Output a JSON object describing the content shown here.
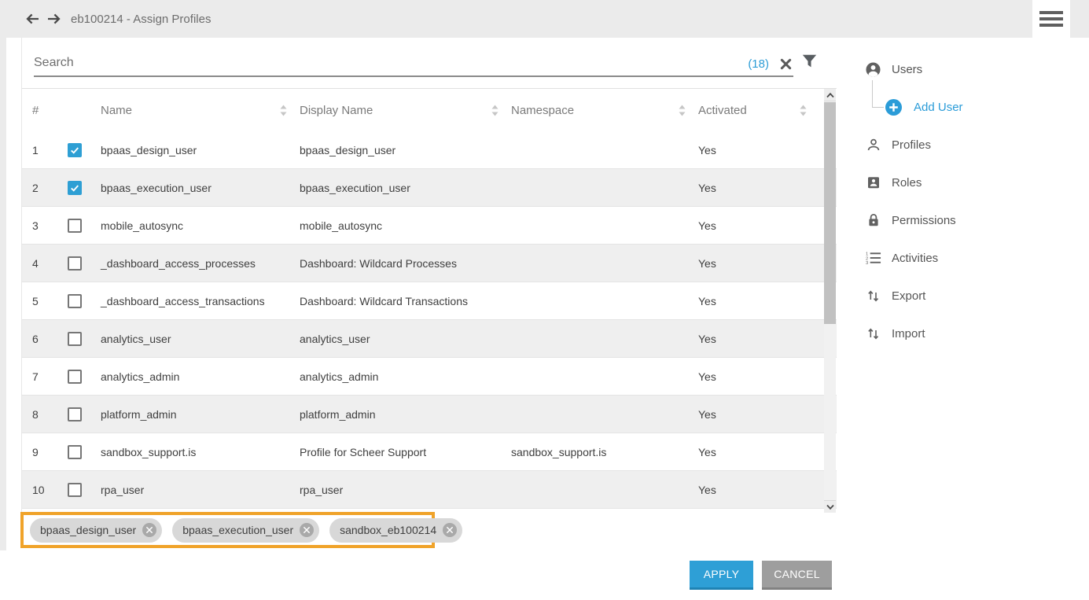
{
  "header": {
    "title": "eb100214 - Assign Profiles"
  },
  "search": {
    "placeholder": "Search",
    "result_count": "(18)"
  },
  "table": {
    "columns": [
      {
        "label": "#",
        "sortable": false
      },
      {
        "label": "Name",
        "sortable": true
      },
      {
        "label": "Display Name",
        "sortable": true
      },
      {
        "label": "Namespace",
        "sortable": true
      },
      {
        "label": "Activated",
        "sortable": true
      }
    ],
    "rows": [
      {
        "num": "1",
        "checked": true,
        "name": "bpaas_design_user",
        "display_name": "bpaas_design_user",
        "namespace": "",
        "activated": "Yes"
      },
      {
        "num": "2",
        "checked": true,
        "name": "bpaas_execution_user",
        "display_name": "bpaas_execution_user",
        "namespace": "",
        "activated": "Yes"
      },
      {
        "num": "3",
        "checked": false,
        "name": "mobile_autosync",
        "display_name": "mobile_autosync",
        "namespace": "",
        "activated": "Yes"
      },
      {
        "num": "4",
        "checked": false,
        "name": "_dashboard_access_processes",
        "display_name": "Dashboard: Wildcard Processes",
        "namespace": "",
        "activated": "Yes"
      },
      {
        "num": "5",
        "checked": false,
        "name": "_dashboard_access_transactions",
        "display_name": "Dashboard: Wildcard Transactions",
        "namespace": "",
        "activated": "Yes"
      },
      {
        "num": "6",
        "checked": false,
        "name": "analytics_user",
        "display_name": "analytics_user",
        "namespace": "",
        "activated": "Yes"
      },
      {
        "num": "7",
        "checked": false,
        "name": "analytics_admin",
        "display_name": "analytics_admin",
        "namespace": "",
        "activated": "Yes"
      },
      {
        "num": "8",
        "checked": false,
        "name": "platform_admin",
        "display_name": "platform_admin",
        "namespace": "",
        "activated": "Yes"
      },
      {
        "num": "9",
        "checked": false,
        "name": "sandbox_support.is",
        "display_name": "Profile for Scheer Support",
        "namespace": "sandbox_support.is",
        "activated": "Yes"
      },
      {
        "num": "10",
        "checked": false,
        "name": "rpa_user",
        "display_name": "rpa_user",
        "namespace": "",
        "activated": "Yes"
      }
    ]
  },
  "selected_chips": [
    {
      "label": "bpaas_design_user"
    },
    {
      "label": "bpaas_execution_user"
    },
    {
      "label": "sandbox_eb100214"
    }
  ],
  "actions": {
    "apply": "APPLY",
    "cancel": "CANCEL"
  },
  "sidebar": {
    "items": [
      {
        "label": "Users",
        "icon": "user-circle-icon",
        "indent": false,
        "accent": false
      },
      {
        "label": "Add User",
        "icon": "add-circle-icon",
        "indent": true,
        "accent": true
      },
      {
        "label": "Profiles",
        "icon": "person-outline-icon",
        "indent": false,
        "accent": false
      },
      {
        "label": "Roles",
        "icon": "badge-icon",
        "indent": false,
        "accent": false
      },
      {
        "label": "Permissions",
        "icon": "lock-icon",
        "indent": false,
        "accent": false
      },
      {
        "label": "Activities",
        "icon": "numbered-list-icon",
        "indent": false,
        "accent": false
      },
      {
        "label": "Export",
        "icon": "import-export-icon",
        "indent": false,
        "accent": false
      },
      {
        "label": "Import",
        "icon": "import-export-icon",
        "indent": false,
        "accent": false
      }
    ]
  },
  "colors": {
    "accent_blue": "#2e9fd4",
    "link_blue": "#2b9cd8",
    "highlight_orange": "#f0a32a",
    "header_gray": "#ebebeb",
    "row_alt_gray": "#efefef",
    "chip_gray": "#d8d8d8",
    "cancel_gray": "#9e9e9e"
  }
}
